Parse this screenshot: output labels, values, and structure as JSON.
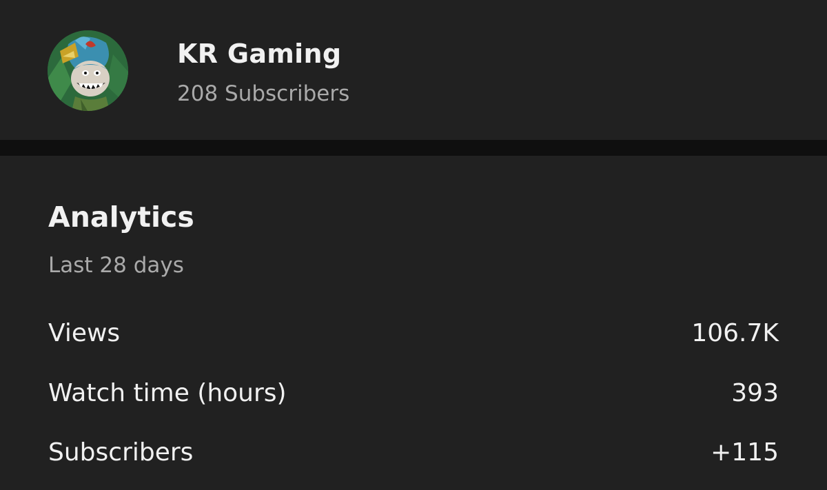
{
  "channel": {
    "name": "KR Gaming",
    "subscribers": "208 Subscribers"
  },
  "analytics": {
    "title": "Analytics",
    "period": "Last 28 days",
    "metrics": [
      {
        "label": "Views",
        "value": "106.7K"
      },
      {
        "label": "Watch time (hours)",
        "value": "393"
      },
      {
        "label": "Subscribers",
        "value": "+115"
      }
    ]
  },
  "colors": {
    "background": "#212121",
    "divider": "#0f0f0f",
    "primary_text": "#f1f1f1",
    "secondary_text": "#aaaaaa"
  }
}
